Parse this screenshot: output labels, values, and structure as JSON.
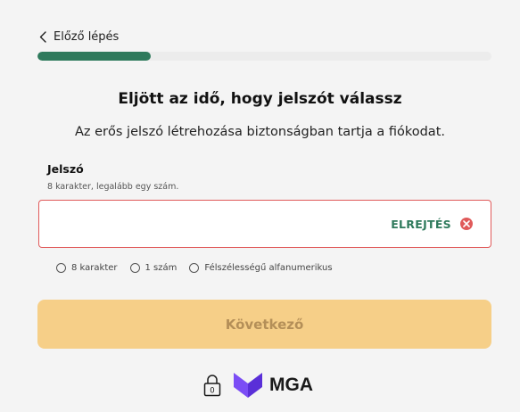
{
  "header": {
    "back_label": "Előző lépés",
    "progress_percent": 25
  },
  "main": {
    "title": "Eljött az idő, hogy jelszót válassz",
    "subtitle": "Az erős jelszó létrehozása biztonságban tartja a fiókodat."
  },
  "password": {
    "label": "Jelszó",
    "hint": "8 karakter, legalább egy szám.",
    "value": "",
    "toggle_label": "ELREJTÉS"
  },
  "rules": [
    {
      "label": "8 karakter"
    },
    {
      "label": "1 szám"
    },
    {
      "label": "Félszélességű alfanumerikus"
    }
  ],
  "actions": {
    "next_label": "Következő"
  },
  "footer": {
    "brand_name": "MGA",
    "lock_digit": "0"
  },
  "colors": {
    "accent_green": "#2f7a5c",
    "error_red": "#e05a5a",
    "button_disabled": "#f6cf88",
    "brand_purple": "#6a3df0"
  },
  "icons": {
    "back": "chevron-left-icon",
    "error": "error-x-icon",
    "lock": "lock-icon",
    "brand": "mga-logo-icon"
  }
}
